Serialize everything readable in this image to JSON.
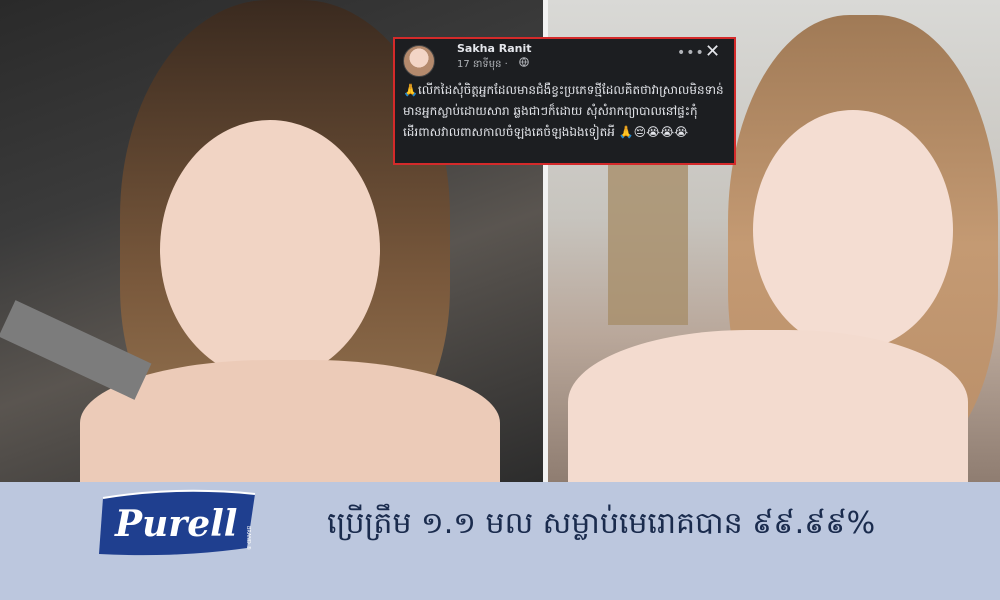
{
  "post": {
    "author": "Sakha Ranit",
    "time": "17 នាទីមុន ·",
    "globe_icon": "globe-icon",
    "more_icon": "more-icon",
    "close_icon": "close-icon",
    "text": "🙏លើកដៃសុំចិត្តអ្នកដែលមានជំងឺខ្វះប្រភេទថ្មីដែលគិតថាវាស្រាលមិនទាន់មានអ្នកស្លាប់ដោយសារា ឆ្លងជាៗក៏ដោយ សុំសំរាកព្យាបាលនៅផ្ទះកុំដើរពាសវាលពាសកាលចំឡងគេចំឡងឯងទៀតអី 🙏😔😭😭😭"
  },
  "banner": {
    "logo_text": "Purell",
    "logo_trademark": "BRAND ®",
    "text": "ប្រើត្រឹម ១.១ មល សម្លាប់មេរោគបាន ៩៩.៩៩%",
    "background_color": "#bcc7de",
    "logo_color": "#1f3f8f"
  }
}
